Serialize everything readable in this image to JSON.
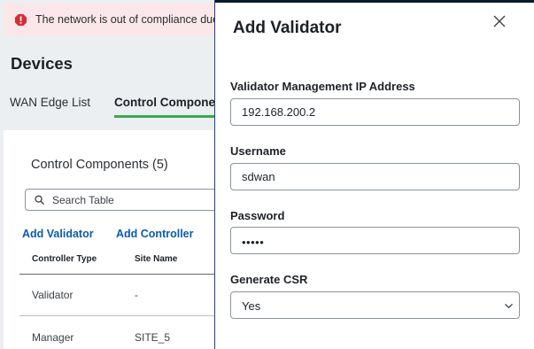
{
  "alert": {
    "text": "The network is out of compliance due to",
    "icon": "error-alert-icon",
    "color": "#d62d3a"
  },
  "page": {
    "title": "Devices"
  },
  "tabs": [
    {
      "label": "WAN Edge List",
      "active": false
    },
    {
      "label": "Control Components",
      "active": true,
      "underline_color": "#3aa853"
    }
  ],
  "card": {
    "title": "Control Components (5)",
    "search_placeholder": "Search Table",
    "actions": {
      "add_validator": "Add Validator",
      "add_controller": "Add Controller"
    },
    "columns": [
      "Controller Type",
      "Site Name"
    ],
    "rows": [
      {
        "type": "Validator",
        "site": "-"
      },
      {
        "type": "Manager",
        "site": "SITE_5"
      }
    ]
  },
  "drawer": {
    "title": "Add Validator",
    "close_icon": "close-icon",
    "fields": {
      "ip": {
        "label": "Validator Management IP Address",
        "value": "192.168.200.2"
      },
      "username": {
        "label": "Username",
        "value": "sdwan"
      },
      "password": {
        "label": "Password",
        "value": "•••••"
      },
      "csr": {
        "label": "Generate CSR",
        "value": "Yes",
        "options": [
          "Yes"
        ]
      }
    }
  }
}
